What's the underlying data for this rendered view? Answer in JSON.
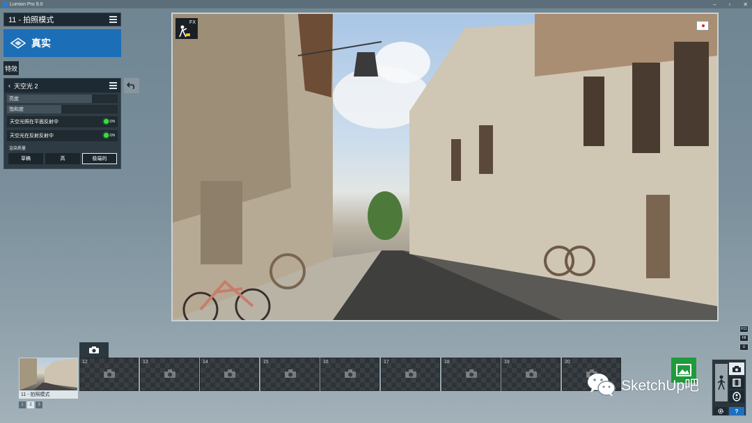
{
  "window": {
    "title": "Lumion Pro 9.0"
  },
  "mode_header": {
    "title": "11 - 拍照模式"
  },
  "style": {
    "label": "真实"
  },
  "effects_tab": {
    "label": "特效"
  },
  "effect": {
    "title": "天空光 2",
    "sliders": [
      {
        "label": "亮度",
        "value": 0.77
      },
      {
        "label": "饱和度",
        "value": 0.49
      }
    ],
    "toggles": [
      {
        "label": "天空光照在平面反射中",
        "state": "ON"
      },
      {
        "label": "天空光在反射反射中",
        "state": "ON"
      }
    ],
    "quality_label": "渲染质量",
    "quality_options": [
      "草稿",
      "高",
      "极端的"
    ],
    "quality_selected": "极端的"
  },
  "side_keys": [
    "F11",
    "F8",
    "U"
  ],
  "filmstrip": {
    "first_slot_label": "11 - 拍照模式",
    "slot_numbers": [
      "12",
      "13",
      "14",
      "15",
      "16",
      "17",
      "18",
      "19",
      "20"
    ],
    "pages": [
      "1",
      "2",
      "3"
    ],
    "active_page": "2"
  },
  "help": {
    "label": "?"
  },
  "watermark": {
    "text": "SketchUp吧"
  },
  "colors": {
    "accent_blue": "#1c6eb6",
    "render_green": "#1e9b3a",
    "toggle_on": "#3ddc3d"
  }
}
